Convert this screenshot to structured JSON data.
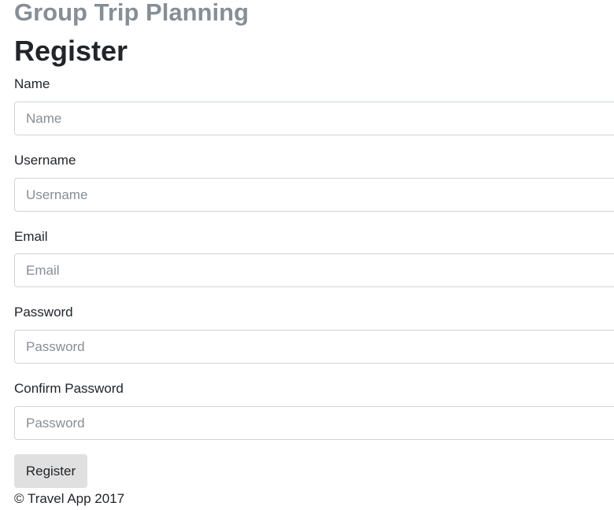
{
  "app": {
    "title": "Group Trip Planning"
  },
  "page": {
    "heading": "Register"
  },
  "form": {
    "fields": [
      {
        "label": "Name",
        "placeholder": "Name",
        "value": ""
      },
      {
        "label": "Username",
        "placeholder": "Username",
        "value": ""
      },
      {
        "label": "Email",
        "placeholder": "Email",
        "value": ""
      },
      {
        "label": "Password",
        "placeholder": "Password",
        "value": ""
      },
      {
        "label": "Confirm Password",
        "placeholder": "Password",
        "value": ""
      }
    ],
    "submit_label": "Register"
  },
  "footer": {
    "text": "© Travel App 2017"
  },
  "colors": {
    "muted_title": "#868e96",
    "text": "#212529",
    "input_border": "#ced4da",
    "button_background": "#e0e0e0"
  }
}
